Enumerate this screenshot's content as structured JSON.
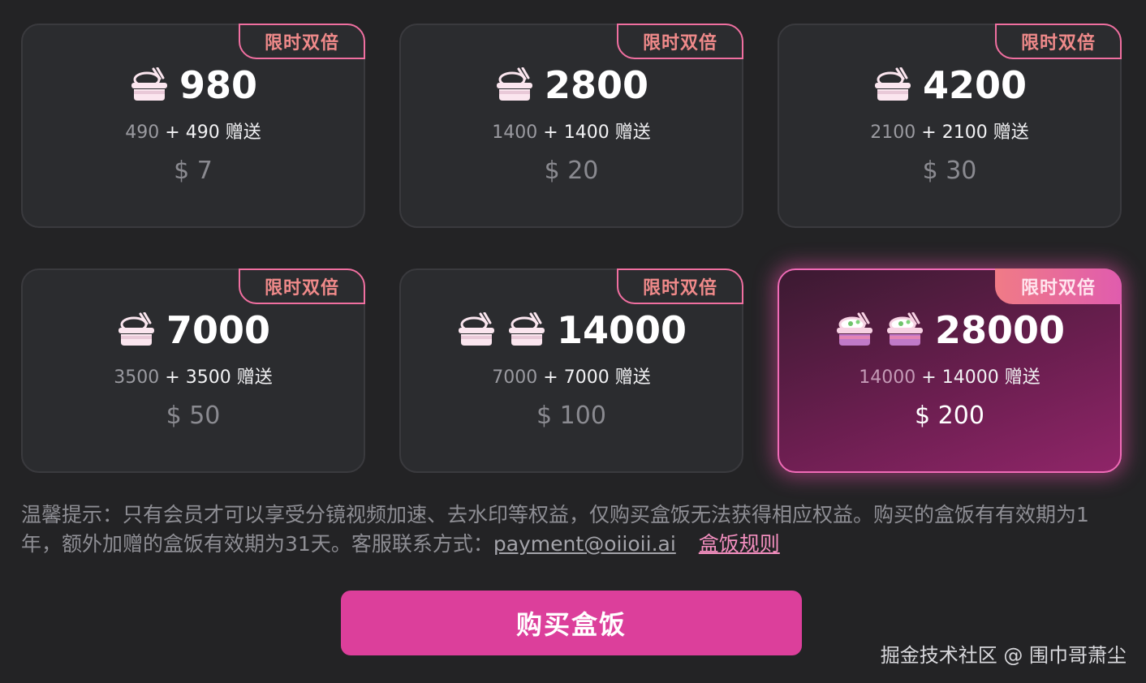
{
  "packages": [
    {
      "badge": "限时双倍",
      "icon_count": 1,
      "icon_style": "outline",
      "amount": "980",
      "base": "490",
      "bonus": "+ 490 赠送",
      "price": "$ 7",
      "selected": false
    },
    {
      "badge": "限时双倍",
      "icon_count": 1,
      "icon_style": "outline",
      "amount": "2800",
      "base": "1400",
      "bonus": "+ 1400 赠送",
      "price": "$ 20",
      "selected": false
    },
    {
      "badge": "限时双倍",
      "icon_count": 1,
      "icon_style": "outline",
      "amount": "4200",
      "base": "2100",
      "bonus": "+ 2100 赠送",
      "price": "$ 30",
      "selected": false
    },
    {
      "badge": "限时双倍",
      "icon_count": 1,
      "icon_style": "outline",
      "amount": "7000",
      "base": "3500",
      "bonus": "+ 3500 赠送",
      "price": "$ 50",
      "selected": false
    },
    {
      "badge": "限时双倍",
      "icon_count": 2,
      "icon_style": "outline",
      "amount": "14000",
      "base": "7000",
      "bonus": "+ 7000 赠送",
      "price": "$ 100",
      "selected": false
    },
    {
      "badge": "限时双倍",
      "icon_count": 2,
      "icon_style": "color",
      "amount": "28000",
      "base": "14000",
      "bonus": "+ 14000 赠送",
      "price": "$ 200",
      "selected": true
    }
  ],
  "notice": {
    "text": "温馨提示：只有会员才可以享受分镜视频加速、去水印等权益，仅购买盒饭无法获得相应权益。购买的盒饭有有效期为1年，额外加赠的盒饭有效期为31天。客服联系方式：",
    "email": "payment@oiioii.ai",
    "rules_link": "盒饭规则"
  },
  "buy_button": "购买盒饭",
  "watermark": "掘金技术社区 @ 围巾哥萧尘",
  "colors": {
    "accent": "#dc3f9b",
    "badge_text": "#f08a8a",
    "card_bg": "#2b2c2f",
    "page_bg": "#232325"
  },
  "icon_names": {
    "rice_box": "rice-box-icon"
  }
}
